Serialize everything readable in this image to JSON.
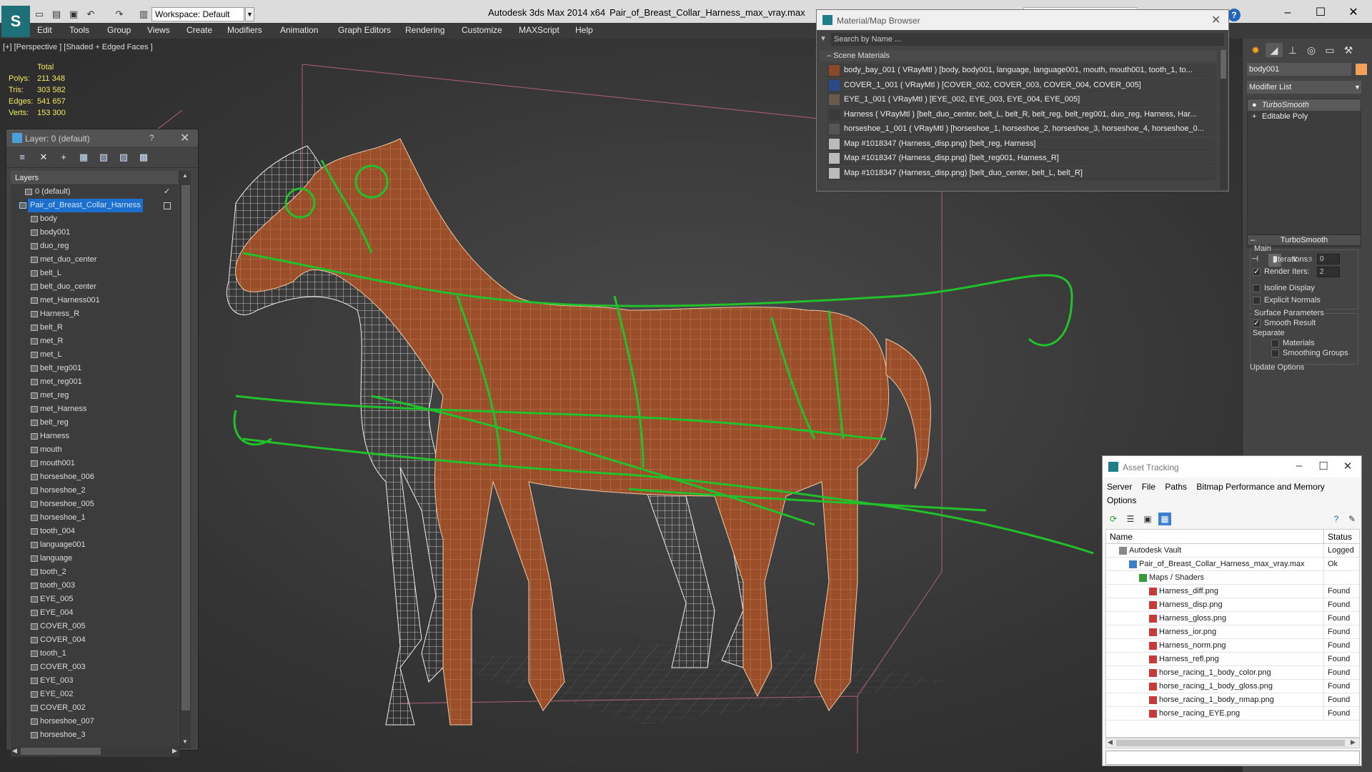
{
  "titlebar": {
    "workspace": "Workspace: Default",
    "app_title": "Autodesk 3ds Max  2014 x64",
    "file_title": "Pair_of_Breast_Collar_Harness_max_vray.max",
    "help": "?"
  },
  "menu": [
    "Edit",
    "Tools",
    "Group",
    "Views",
    "Create",
    "Modifiers",
    "Animation",
    "Graph Editors",
    "Rendering",
    "Customize",
    "MAXScript",
    "Help"
  ],
  "viewport": {
    "label": "[+] [Perspective ] [Shaded + Edged Faces ]",
    "stats": {
      "header": "Total",
      "rows": [
        {
          "label": "Polys:",
          "value": "211 348"
        },
        {
          "label": "Tris:",
          "value": "303 582"
        },
        {
          "label": "Edges:",
          "value": "541 657"
        },
        {
          "label": "Verts:",
          "value": "153 300"
        }
      ]
    }
  },
  "layer_panel": {
    "title": "Layer: 0 (default)",
    "help": "?",
    "header": "Layers",
    "default_layer": "0 (default)",
    "selected_layer": "Pair_of_Breast_Collar_Harness",
    "objects": [
      "body",
      "body001",
      "duo_reg",
      "met_duo_center",
      "belt_L",
      "belt_duo_center",
      "met_Harness001",
      "Harness_R",
      "belt_R",
      "met_R",
      "met_L",
      "belt_reg001",
      "met_reg001",
      "met_reg",
      "met_Harness",
      "belt_reg",
      "Harness",
      "mouth",
      "mouth001",
      "horseshoe_006",
      "horseshoe_2",
      "horseshoe_005",
      "horseshoe_1",
      "tooth_004",
      "language001",
      "language",
      "tooth_2",
      "tooth_003",
      "EYE_005",
      "EYE_004",
      "COVER_005",
      "COVER_004",
      "tooth_1",
      "COVER_003",
      "EYE_003",
      "EYE_002",
      "COVER_002",
      "horseshoe_007",
      "horseshoe_3"
    ]
  },
  "material_browser": {
    "title": "Material/Map Browser",
    "search_placeholder": "Search by Name ...",
    "section": "Scene Materials",
    "items": [
      {
        "text": "body_bay_001  ( VRayMtl )  [body, body001, language, language001, mouth, mouth001, tooth_1, to...",
        "swatch": "#8a4a2a"
      },
      {
        "text": "COVER_1_001  ( VRayMtl )  [COVER_002, COVER_003, COVER_004, COVER_005]",
        "swatch": "#2a4a8a"
      },
      {
        "text": "EYE_1_001  ( VRayMtl )  [EYE_002, EYE_003, EYE_004, EYE_005]",
        "swatch": "#6a5a4a"
      },
      {
        "text": "Harness  ( VRayMtl )  [belt_duo_center, belt_L, belt_R, belt_reg, belt_reg001, duo_reg, Harness, Har...",
        "swatch": "#3a3a3a"
      },
      {
        "text": "horseshoe_1_001  ( VRayMtl )  [horseshoe_1, horseshoe_2, horseshoe_3, horseshoe_4, horseshoe_0...",
        "swatch": "#555555"
      },
      {
        "text": "Map #1018347 (Harness_disp.png)  [belt_reg, Harness]",
        "swatch": "#bbbbbb"
      },
      {
        "text": "Map #1018347 (Harness_disp.png)  [belt_reg001, Harness_R]",
        "swatch": "#bbbbbb"
      },
      {
        "text": "Map #1018347 (Harness_disp.png)  [belt_duo_center, belt_L, belt_R]",
        "swatch": "#bbbbbb"
      }
    ]
  },
  "command_panel": {
    "object_name": "body001",
    "object_color": "#f2a05a",
    "modifier_list": "Modifier List",
    "stack": [
      "TurboSmooth",
      "Editable Poly"
    ],
    "turbosmooth": {
      "title": "TurboSmooth",
      "main": "Main",
      "iterations_label": "Iterations:",
      "iterations": "0",
      "render_iters_label": "Render Iters:",
      "render_iters": "2",
      "isoline": "Isoline Display",
      "explicit": "Explicit Normals",
      "surface": "Surface Parameters",
      "smooth_result": "Smooth Result",
      "separate": "Separate",
      "materials": "Materials",
      "smoothing_groups": "Smoothing Groups",
      "update": "Update Options"
    }
  },
  "asset_tracking": {
    "title": "Asset Tracking",
    "menu": [
      "Server",
      "File",
      "Paths",
      "Bitmap Performance and Memory",
      "Options"
    ],
    "columns": [
      "Name",
      "Status"
    ],
    "rows": [
      {
        "name": "Autodesk Vault",
        "status": "Logged",
        "indent": 0,
        "icon": "#888"
      },
      {
        "name": "Pair_of_Breast_Collar_Harness_max_vray.max",
        "status": "Ok",
        "indent": 1,
        "icon": "#3a7fc8"
      },
      {
        "name": "Maps / Shaders",
        "status": "",
        "indent": 2,
        "icon": "#3a9a3a"
      },
      {
        "name": "Harness_diff.png",
        "status": "Found",
        "indent": 3,
        "icon": "#c83a3a"
      },
      {
        "name": "Harness_disp.png",
        "status": "Found",
        "indent": 3,
        "icon": "#c83a3a"
      },
      {
        "name": "Harness_gloss.png",
        "status": "Found",
        "indent": 3,
        "icon": "#c83a3a"
      },
      {
        "name": "Harness_ior.png",
        "status": "Found",
        "indent": 3,
        "icon": "#c83a3a"
      },
      {
        "name": "Harness_norm.png",
        "status": "Found",
        "indent": 3,
        "icon": "#c83a3a"
      },
      {
        "name": "Harness_refl.png",
        "status": "Found",
        "indent": 3,
        "icon": "#c83a3a"
      },
      {
        "name": "horse_racing_1_body_color.png",
        "status": "Found",
        "indent": 3,
        "icon": "#c83a3a"
      },
      {
        "name": "horse_racing_1_body_gloss.png",
        "status": "Found",
        "indent": 3,
        "icon": "#c83a3a"
      },
      {
        "name": "horse_racing_1_body_nmap.png",
        "status": "Found",
        "indent": 3,
        "icon": "#c83a3a"
      },
      {
        "name": "horse_racing_EYE.png",
        "status": "Found",
        "indent": 3,
        "icon": "#c83a3a"
      }
    ]
  }
}
